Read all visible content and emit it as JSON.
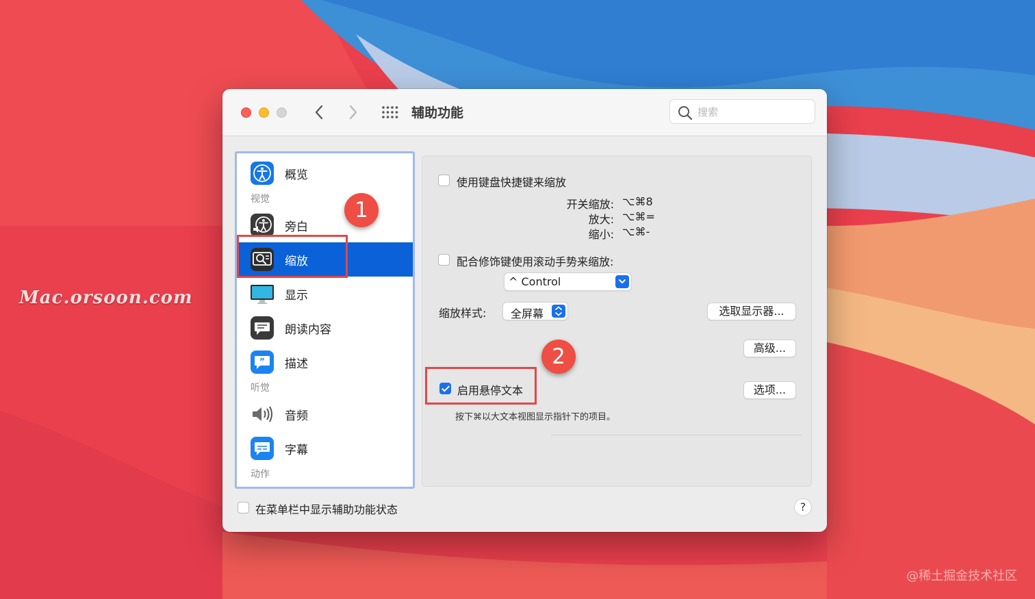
{
  "wallpaper": {
    "watermark_left": "Mac.orsoon.com",
    "watermark_right": "@稀土掘金技术社区"
  },
  "window": {
    "title": "辅助功能",
    "search_placeholder": "搜索"
  },
  "sidebar": {
    "items": [
      {
        "label": "概览",
        "icon": "accessibility-icon"
      },
      {
        "label": "旁白",
        "icon": "voiceover-icon"
      },
      {
        "label": "缩放",
        "icon": "zoom-icon",
        "selected": true
      },
      {
        "label": "显示",
        "icon": "display-icon"
      },
      {
        "label": "朗读内容",
        "icon": "speech-icon"
      },
      {
        "label": "描述",
        "icon": "descriptions-icon"
      },
      {
        "label": "音频",
        "icon": "speaker-icon"
      },
      {
        "label": "字幕",
        "icon": "captions-icon"
      }
    ],
    "headers": {
      "vision": "视觉",
      "hearing": "听觉",
      "motor": "动作"
    }
  },
  "annotations": {
    "badge1": "1",
    "badge2": "2",
    "color": "#e0484a"
  },
  "panel": {
    "keyboard_shortcuts_label": "使用键盘快捷键来缩放",
    "keyboard_shortcuts_checked": false,
    "shortcuts": [
      {
        "label": "开关缩放:",
        "keys": "⌥⌘8"
      },
      {
        "label": "放大:",
        "keys": "⌥⌘="
      },
      {
        "label": "缩小:",
        "keys": "⌥⌘-"
      }
    ],
    "scroll_gesture_label": "配合修饰键使用滚动手势来缩放:",
    "scroll_gesture_checked": false,
    "modifier_value": "^ Control",
    "zoom_style_label": "缩放样式:",
    "zoom_style_value": "全屏幕",
    "choose_display_button": "选取显示器...",
    "advanced_button": "高级...",
    "hover_text_label": "启用悬停文本",
    "hover_text_checked": true,
    "options_button": "选项...",
    "hover_text_hint": "按下⌘以大文本视图显示指针下的项目。"
  },
  "footer": {
    "menubar_status_label": "在菜单栏中显示辅助功能状态",
    "menubar_status_checked": false,
    "help_label": "?"
  },
  "colors": {
    "accent": "#0a61d8",
    "checkbox_accent": "#1a6ff0"
  }
}
